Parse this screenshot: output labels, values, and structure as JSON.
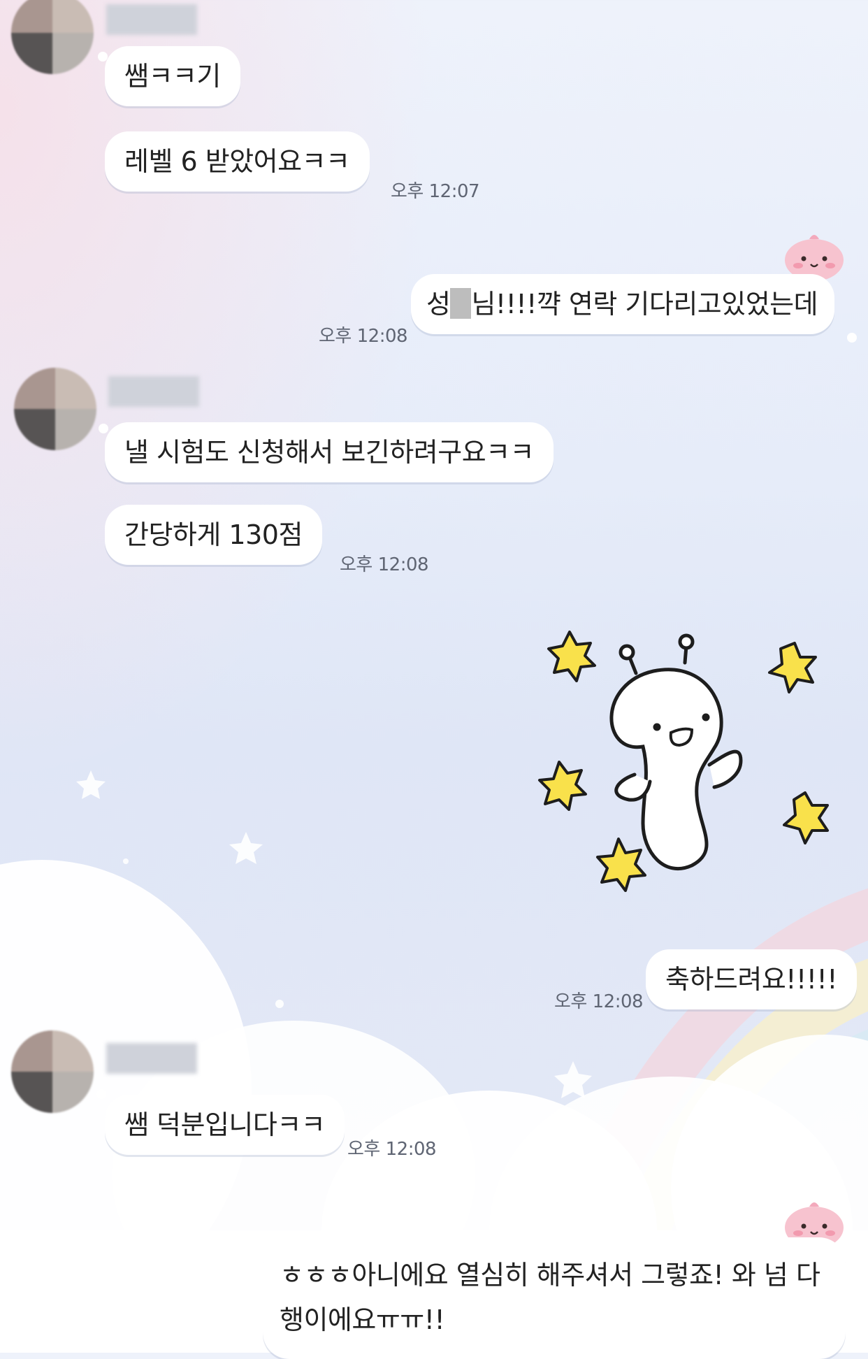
{
  "messages": [
    {
      "text": "쌤ㅋㅋ기"
    },
    {
      "text": "레벨 6  받았어요ㅋㅋ",
      "time": "오후 12:07"
    },
    {
      "text_before": "성",
      "text_after": "님!!!!꺅 연락 기다리고있었는데",
      "time": "오후 12:08"
    },
    {
      "text": "낼 시험도 신청해서 보긴하려구요ㅋㅋ"
    },
    {
      "text": "간당하게 130점",
      "time": "오후 12:08"
    },
    {
      "text": "축하드려요!!!!!",
      "time": "오후 12:08"
    },
    {
      "text": "쌤 덕분입니다ㅋㅋ",
      "time": "오후 12:08"
    },
    {
      "text": "ㅎㅎㅎ아니에요 열심히 해주셔서 그렇죠! 와 넘 다행이에요ㅠㅠ!!"
    }
  ],
  "colors": {
    "bubble": "#ffffff",
    "text": "#222222",
    "time": "#5f6573",
    "star_yellow": "#f9e14b",
    "peach": "#f7c3cf"
  },
  "icons": {
    "sticker": "waving-character-with-stars-sticker",
    "profile_badge": "peach-character-icon"
  }
}
